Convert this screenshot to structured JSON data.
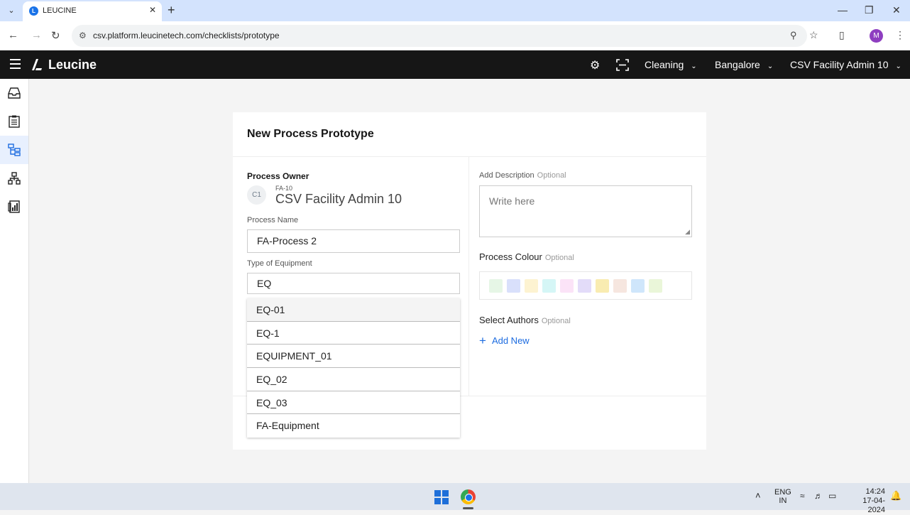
{
  "browser": {
    "tab_title": "LEUCINE",
    "favicon_letter": "L",
    "url": "csv.platform.leucinetech.com/checklists/prototype",
    "profile_initial": "M"
  },
  "app": {
    "brand": "Leucine",
    "facility_selector": "Cleaning",
    "location_selector": "Bangalore",
    "user_selector": "CSV Facility Admin 10"
  },
  "form": {
    "title": "New Process Prototype",
    "owner_label": "Process Owner",
    "owner_initials": "C1",
    "owner_id": "FA-10",
    "owner_name": "CSV Facility Admin 10",
    "process_name_label": "Process Name",
    "process_name_value": "FA-Process 2",
    "equipment_label": "Type of Equipment",
    "equipment_value": "EQ",
    "equipment_options": [
      "EQ-01",
      "EQ-1",
      "EQUIPMENT_01",
      "EQ_02",
      "EQ_03",
      "FA-Equipment"
    ],
    "description_label": "Add Description",
    "description_optional": "Optional",
    "description_placeholder": "Write here",
    "colour_label": "Process Colour",
    "colour_optional": "Optional",
    "colour_swatches": [
      "#e6f6e6",
      "#d9e0fb",
      "#fdf3d1",
      "#d5f6f6",
      "#fbe3f7",
      "#e3dcf9",
      "#f9ecb1",
      "#f6e6df",
      "#cfe6fb",
      "#eaf6d9"
    ],
    "authors_label": "Select Authors",
    "authors_optional": "Optional",
    "add_new_label": "Add New"
  },
  "taskbar": {
    "lang_top": "ENG",
    "lang_bottom": "IN",
    "time": "14:24",
    "date": "17-04-2024"
  }
}
